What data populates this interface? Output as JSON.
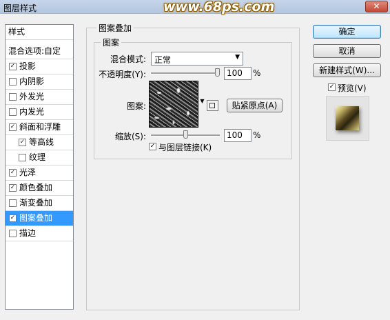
{
  "window": {
    "title": "图层样式",
    "watermark": "www.68ps.com",
    "close_label": "✕"
  },
  "styles_list": {
    "header": "样式",
    "blend_options": "混合选项:自定",
    "items": [
      {
        "label": "投影",
        "checked": true
      },
      {
        "label": "内阴影",
        "checked": false
      },
      {
        "label": "外发光",
        "checked": false
      },
      {
        "label": "内发光",
        "checked": false
      },
      {
        "label": "斜面和浮雕",
        "checked": true
      },
      {
        "label": "等高线",
        "checked": true
      },
      {
        "label": "纹理",
        "checked": false
      },
      {
        "label": "光泽",
        "checked": true
      },
      {
        "label": "颜色叠加",
        "checked": true
      },
      {
        "label": "渐变叠加",
        "checked": false
      },
      {
        "label": "图案叠加",
        "checked": true,
        "selected": true
      },
      {
        "label": "描边",
        "checked": false
      }
    ]
  },
  "main": {
    "group_title": "图案叠加",
    "subgroup_title": "图案",
    "blend_mode_label": "混合模式:",
    "blend_mode_value": "正常",
    "opacity_label": "不透明度(Y):",
    "opacity_value": "100",
    "opacity_fraction": 1.0,
    "pattern_label": "图案:",
    "snap_origin_button": "贴紧原点(A)",
    "scale_label": "缩放(S):",
    "scale_value": "100",
    "scale_fraction": 0.5,
    "percent": "%",
    "link_layer_label": "与图层链接(K)",
    "link_layer_checked": true
  },
  "right": {
    "ok_button": "确定",
    "cancel_button": "取消",
    "new_style_button": "新建样式(W)...",
    "preview_label": "预览(V)",
    "preview_checked": true
  },
  "check_glyph": "✓"
}
